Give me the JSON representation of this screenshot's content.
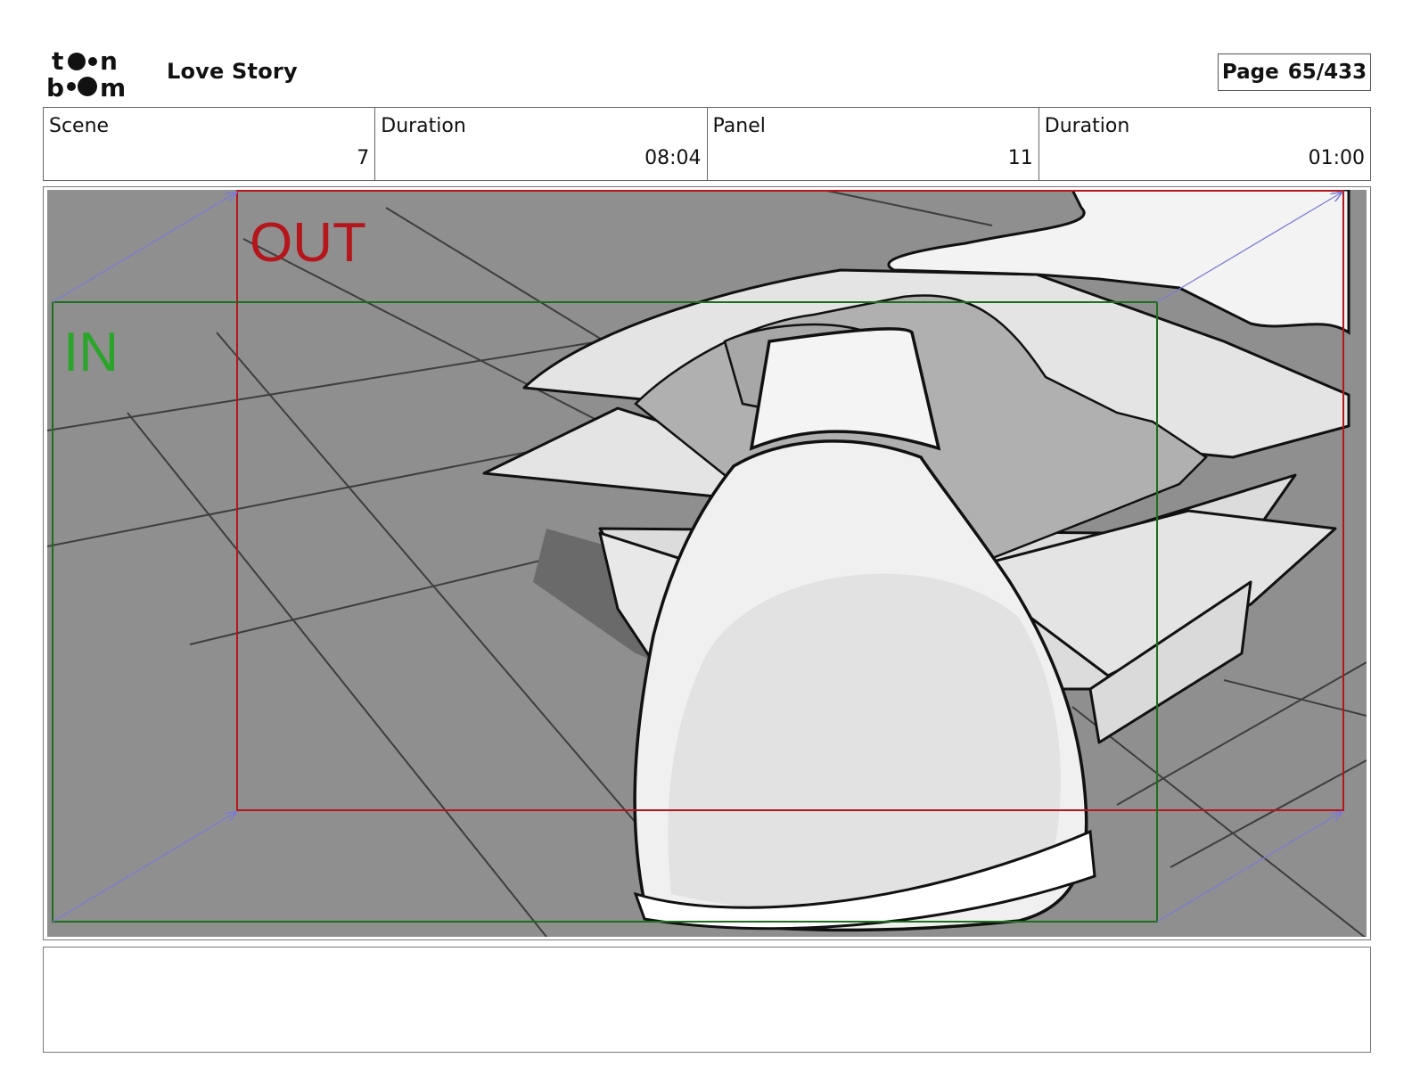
{
  "header": {
    "logo": {
      "line1": "toon",
      "line2": "boom",
      "icon": "toon-boom-logo"
    },
    "project_title": "Love Story",
    "page_label": "Page",
    "page_number": "65/433"
  },
  "info": [
    {
      "label": "Scene",
      "value": "7"
    },
    {
      "label": "Duration",
      "value": "08:04"
    },
    {
      "label": "Panel",
      "value": "11"
    },
    {
      "label": "Duration",
      "value": "01:00"
    }
  ],
  "panel": {
    "out_label": "OUT",
    "in_label": "IN",
    "colors": {
      "out_frame": "#b4161c",
      "in_frame": "#1f6e1f",
      "in_text": "#2aa52a",
      "camera_arrows": "#7b7bd6",
      "floor": "#8f8f8f"
    }
  },
  "notes": {
    "text": ""
  }
}
